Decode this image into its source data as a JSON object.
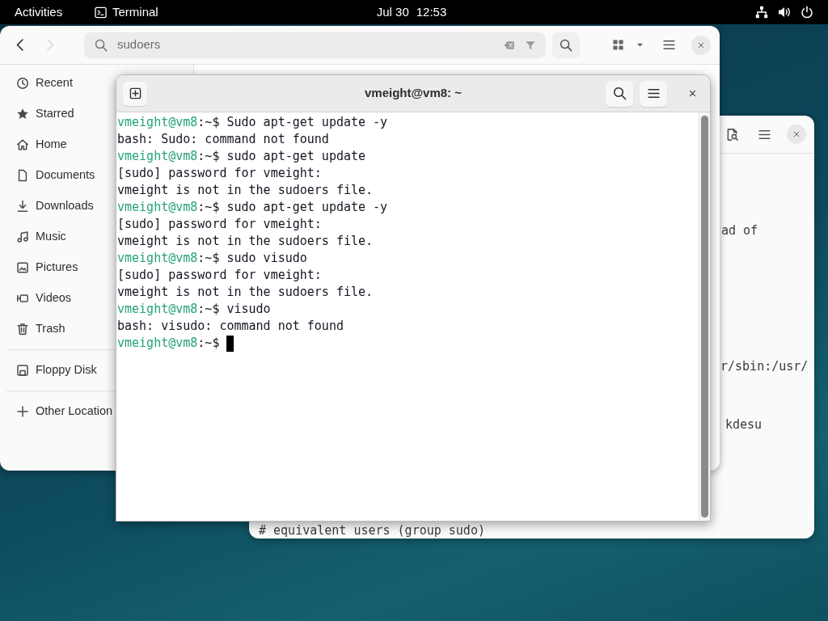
{
  "top_bar": {
    "activities": "Activities",
    "app": "Terminal",
    "date": "Jul 30",
    "time": "12:53"
  },
  "editor_window": {
    "fragments": [
      {
        "text": "ad of"
      },
      {
        "text": "r/sbin:/usr/"
      },
      {
        "text": "kdesu"
      },
      {
        "text": "# equivalent users (group sudo)"
      }
    ]
  },
  "files_window": {
    "nav": [
      {
        "kind": "back",
        "disabled": false
      },
      {
        "kind": "forward",
        "disabled": true
      }
    ],
    "search": {
      "value": "sudoers"
    },
    "sidebar": {
      "sections": [
        {
          "items": [
            {
              "kind": "recent",
              "label": "Recent",
              "selected": false
            },
            {
              "kind": "starred",
              "label": "Starred",
              "selected": false
            },
            {
              "kind": "home",
              "label": "Home",
              "selected": false
            },
            {
              "kind": "documents",
              "label": "Documents",
              "selected": false
            },
            {
              "kind": "downloads",
              "label": "Downloads",
              "selected": false
            },
            {
              "kind": "music",
              "label": "Music",
              "selected": false
            },
            {
              "kind": "pictures",
              "label": "Pictures",
              "selected": false
            },
            {
              "kind": "videos",
              "label": "Videos",
              "selected": false
            },
            {
              "kind": "trash",
              "label": "Trash",
              "selected": false
            }
          ]
        },
        {
          "items": [
            {
              "kind": "drive",
              "label": "Floppy Disk",
              "selected": false
            }
          ]
        },
        {
          "items": [
            {
              "kind": "other",
              "label": "Other Location",
              "selected": false
            }
          ]
        }
      ]
    }
  },
  "terminal": {
    "title": "vmeight@vm8: ~",
    "cursor": true,
    "lines": [
      {
        "kind": "prompt",
        "user_host": "vmeight@vm8",
        "path": ":~$",
        "command": "Sudo apt-get update -y"
      },
      {
        "kind": "output",
        "text": "bash: Sudo: command not found"
      },
      {
        "kind": "prompt",
        "user_host": "vmeight@vm8",
        "path": ":~$",
        "command": "sudo apt-get update"
      },
      {
        "kind": "output",
        "text": "[sudo] password for vmeight:"
      },
      {
        "kind": "output",
        "text": "vmeight is not in the sudoers file."
      },
      {
        "kind": "prompt",
        "user_host": "vmeight@vm8",
        "path": ":~$",
        "command": "sudo apt-get update -y"
      },
      {
        "kind": "output",
        "text": "[sudo] password for vmeight:"
      },
      {
        "kind": "output",
        "text": "vmeight is not in the sudoers file."
      },
      {
        "kind": "prompt",
        "user_host": "vmeight@vm8",
        "path": ":~$",
        "command": "sudo visudo"
      },
      {
        "kind": "output",
        "text": "[sudo] password for vmeight:"
      },
      {
        "kind": "output",
        "text": "vmeight is not in the sudoers file."
      },
      {
        "kind": "prompt",
        "user_host": "vmeight@vm8",
        "path": ":~$",
        "command": "visudo"
      },
      {
        "kind": "output",
        "text": "bash: visudo: command not found"
      },
      {
        "kind": "prompt",
        "user_host": "vmeight@vm8",
        "path": ":~$"
      }
    ]
  }
}
